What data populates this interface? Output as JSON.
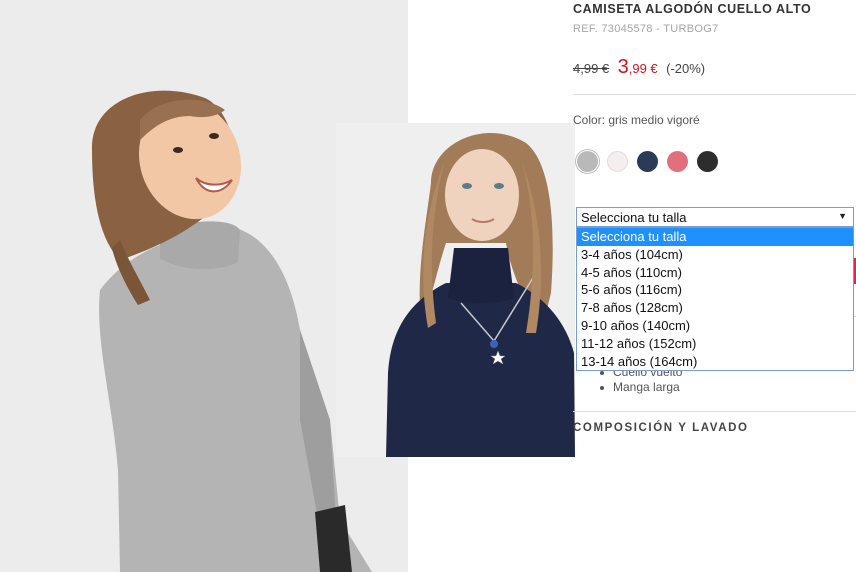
{
  "product": {
    "title": "CAMISETA ALGODÓN CUELLO ALTO",
    "ref": "REF. 73045578 - TURBOG7"
  },
  "price": {
    "old": "4,99 €",
    "new_int": "3",
    "new_dec": ",99 €",
    "discount": "(-20%)"
  },
  "color": {
    "label": "Color: gris medio vigoré",
    "swatches": [
      {
        "name": "gris medio vigoré",
        "hex": "#b9b9b9",
        "selected": true
      },
      {
        "name": "crudo",
        "hex": "#f4eeee",
        "selected": false
      },
      {
        "name": "marino",
        "hex": "#2b3a55",
        "selected": false
      },
      {
        "name": "rosa",
        "hex": "#e0707c",
        "selected": false
      },
      {
        "name": "negro",
        "hex": "#2d2d2d",
        "selected": false
      }
    ]
  },
  "size_select": {
    "selected": "Selecciona tu talla",
    "options": [
      "Selecciona tu talla",
      "3-4 años (104cm)",
      "4-5 años (110cm)",
      "5-6 años (116cm)",
      "7-8 años (128cm)",
      "9-10 años (140cm)",
      "11-12 años (152cm)",
      "13-14 años (164cm)"
    ]
  },
  "features": [
    "Cuello vuelto",
    "Manga larga"
  ],
  "composition_heading": "COMPOSICIÓN Y LAVADO"
}
